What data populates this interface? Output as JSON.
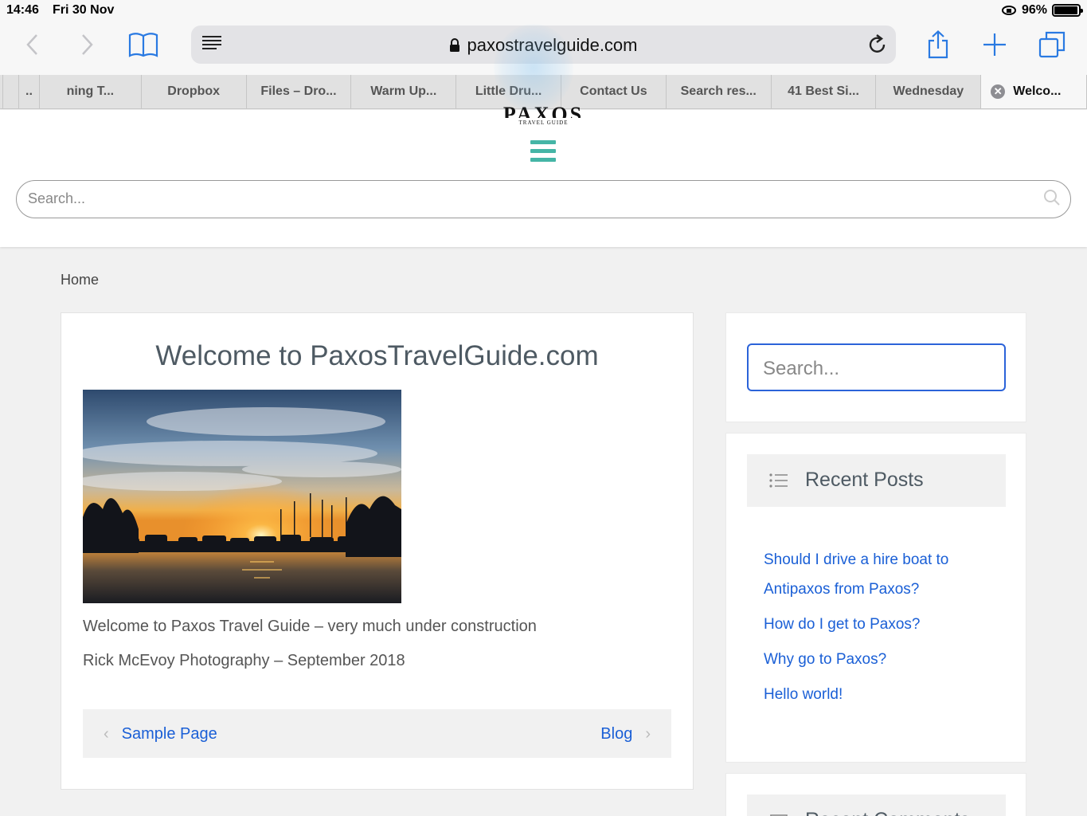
{
  "status": {
    "time": "14:46",
    "date": "Fri 30 Nov",
    "battery": "96%",
    "battery_level": 0.96
  },
  "browser": {
    "url": "paxostravelguide.com",
    "tabs": [
      {
        "label": "..",
        "active": false
      },
      {
        "label": "ning T...",
        "active": false
      },
      {
        "label": "Dropbox",
        "active": false
      },
      {
        "label": "Files – Dro...",
        "active": false
      },
      {
        "label": "Warm Up...",
        "active": false
      },
      {
        "label": "Little Dru...",
        "active": false
      },
      {
        "label": "Contact Us",
        "active": false
      },
      {
        "label": "Search res...",
        "active": false
      },
      {
        "label": "41 Best Si...",
        "active": false
      },
      {
        "label": "Wednesday",
        "active": false
      },
      {
        "label": "Welco...",
        "active": true
      }
    ]
  },
  "site": {
    "logo_text": "PAXOS",
    "logo_sub": "TRAVEL GUIDE",
    "header_search_placeholder": "Search...",
    "breadcrumb": "Home",
    "article": {
      "title": "Welcome to PaxosTravelGuide.com",
      "paragraph1": "Welcome to Paxos Travel Guide – very much under construction",
      "paragraph2": "Rick McEvoy Photography – September 2018",
      "prev_label": "Sample Page",
      "next_label": "Blog"
    },
    "sidebar": {
      "search_placeholder": "Search...",
      "recent_posts_title": "Recent Posts",
      "recent_posts": [
        "Should I drive a hire boat to Antipaxos from Paxos?",
        "How do I get to Paxos?",
        "Why go to Paxos?",
        "Hello world!"
      ],
      "recent_comments_title": "Recent Comments"
    }
  }
}
